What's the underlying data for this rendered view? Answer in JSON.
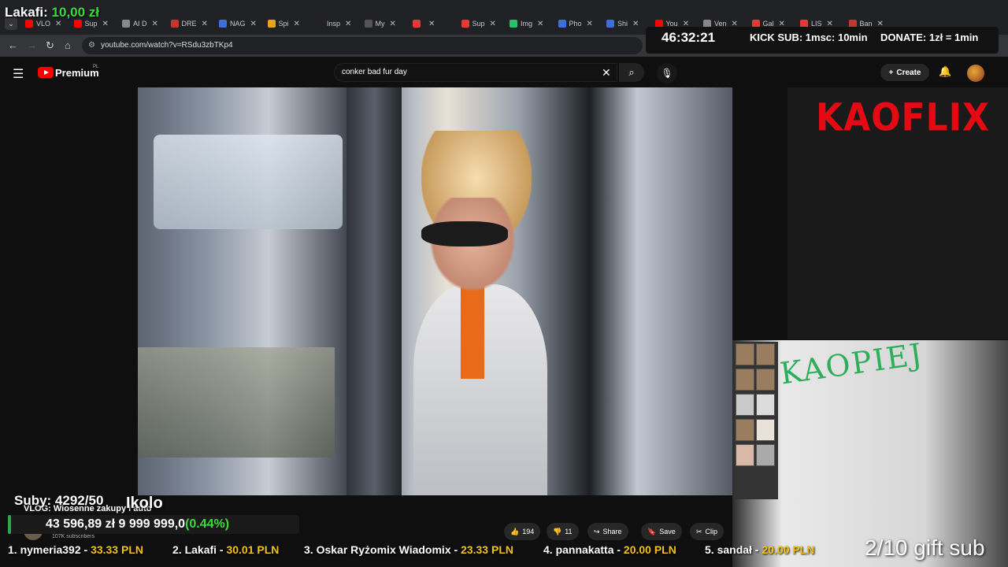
{
  "browser": {
    "tabs": [
      {
        "label": "VLO",
        "color": "#ff0000"
      },
      {
        "label": "Sup",
        "color": "#ff0000"
      },
      {
        "label": "AI D",
        "color": "#888888"
      },
      {
        "label": "DRE",
        "color": "#c0392b"
      },
      {
        "label": "NAG",
        "color": "#3b6fd9"
      },
      {
        "label": "Spi",
        "color": "#e8a31a"
      },
      {
        "label": "Insp",
        "color": "#222222"
      },
      {
        "label": "My",
        "color": "#555555"
      },
      {
        "label": "",
        "color": "#e53935"
      },
      {
        "label": "Sup",
        "color": "#e53935"
      },
      {
        "label": "Img",
        "color": "#2bbf6a"
      },
      {
        "label": "Pho",
        "color": "#3b6fd9"
      },
      {
        "label": "Shi",
        "color": "#3b6fd9"
      },
      {
        "label": "You",
        "color": "#ff0000"
      },
      {
        "label": "Ven",
        "color": "#888888"
      },
      {
        "label": "Gal",
        "color": "#e53935"
      },
      {
        "label": "LIS",
        "color": "#e53935"
      },
      {
        "label": "Ban",
        "color": "#c0392b"
      }
    ],
    "url": "youtube.com/watch?v=RSdu3zbTKp4"
  },
  "overlay": {
    "lakafi_label": "Lakafi:",
    "lakafi_amount": "10,00 zł",
    "timer": "46:32:21",
    "kick_sub": "KICK SUB: 1msc: 10min",
    "donate": "DONATE: 1zł = 1min",
    "subs": "Suby: 4292/50",
    "ikolo": "Ikolo",
    "goal_amount": "43 596,89 zł",
    "goal_target": "9 999 999,0",
    "goal_pct": "(0.44%)",
    "goal_fraction": 0.0044,
    "gift_sub": "2/10 gift sub",
    "kaoflix": "KAOFLIX",
    "kaopiej": "KAOPIEJ"
  },
  "youtube": {
    "premium": "Premium",
    "region": "PL",
    "search_value": "conker bad fur day",
    "create_label": "Create",
    "video_title": "VLOG: Wiosenne zakupy i auto",
    "subscribers": "107K subscribers",
    "likes": "194",
    "dislikes": "11",
    "share": "Share",
    "save": "Save",
    "clip": "Clip"
  },
  "ticker": [
    {
      "name": "1. nymeria392 - ",
      "amount": "33.33 PLN"
    },
    {
      "name": "2. Lakafi - ",
      "amount": "30.01 PLN"
    },
    {
      "name": "3. Oskar Ryżomix Wiadomix - ",
      "amount": "23.33 PLN"
    },
    {
      "name": "4. pannakatta - ",
      "amount": "20.00 PLN"
    },
    {
      "name": "5. sandał - ",
      "amount": "20.00 PLN"
    }
  ]
}
